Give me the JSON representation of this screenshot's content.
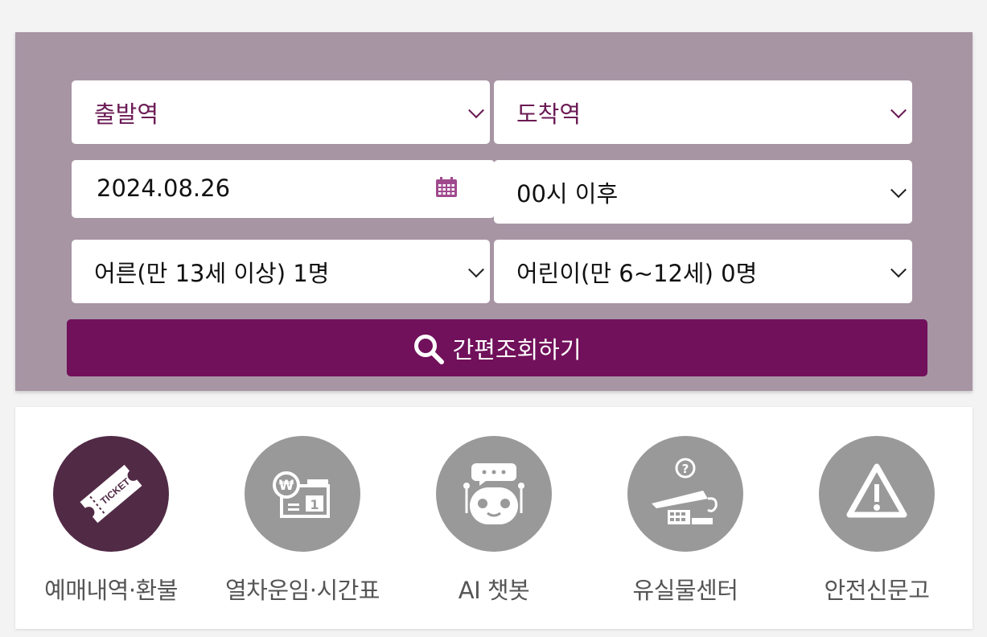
{
  "search": {
    "departure": {
      "value": "출발역"
    },
    "arrival": {
      "value": "도착역"
    },
    "date": {
      "value": "2024.08.26"
    },
    "time": {
      "value": "00시 이후"
    },
    "adult": {
      "value": "어른(만 13세 이상) 1명"
    },
    "child": {
      "value": "어린이(만 6~12세) 0명"
    },
    "button_label": "간편조회하기"
  },
  "quick_menu": {
    "items": [
      {
        "label": "예매내역·환불",
        "icon": "ticket-icon",
        "active": true
      },
      {
        "label": "열차운임·시간표",
        "icon": "fare-timetable-icon",
        "active": false
      },
      {
        "label": "AI 챗봇",
        "icon": "chatbot-icon",
        "active": false
      },
      {
        "label": "유실물센터",
        "icon": "lost-and-found-icon",
        "active": false
      },
      {
        "label": "안전신문고",
        "icon": "warning-icon",
        "active": false
      }
    ],
    "ticket_text": "TICKET"
  },
  "colors": {
    "panel_bg": "#a795a4",
    "accent_purple": "#71105b",
    "active_circle": "#512a46",
    "inactive_circle": "#999999"
  }
}
